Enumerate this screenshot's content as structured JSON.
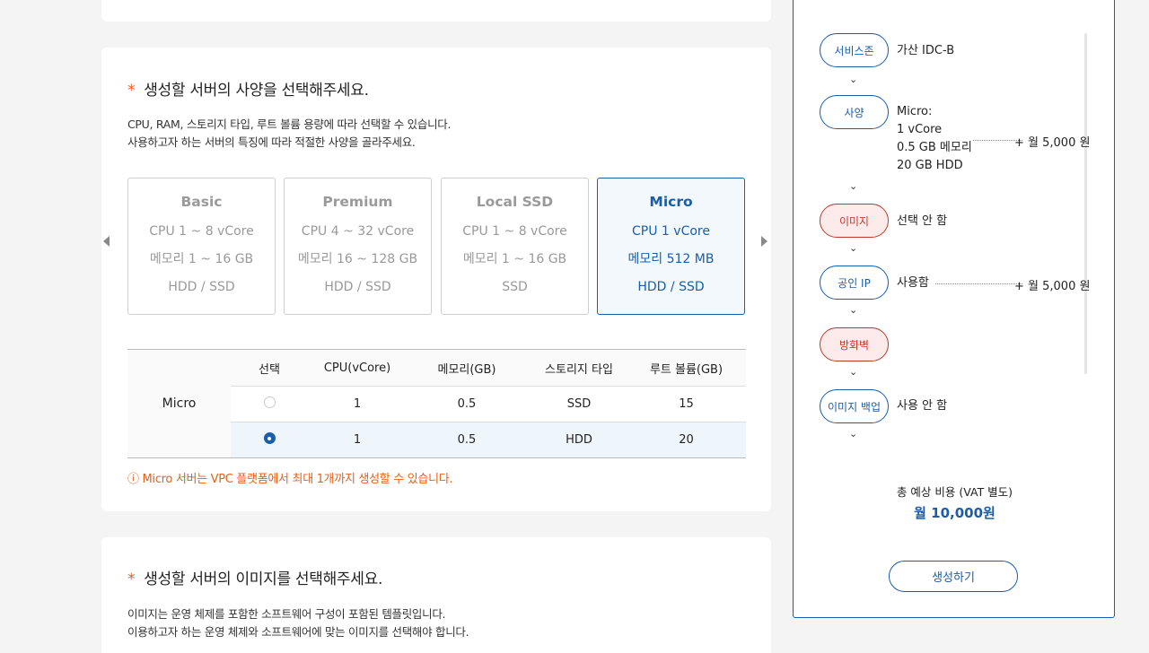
{
  "spec_section": {
    "title": "생성할 서버의 사양을 선택해주세요.",
    "desc_line1": "CPU, RAM, 스토리지 타입, 루트 볼륨 용량에 따라 선택할 수 있습니다.",
    "desc_line2": "사용하고자 하는 서버의 특징에 따라 적절한 사양을 골라주세요.",
    "cards": [
      {
        "title": "Basic",
        "cpu": "CPU 1 ~ 8 vCore",
        "mem": "메모리 1 ~ 16 GB",
        "storage": "HDD / SSD"
      },
      {
        "title": "Premium",
        "cpu": "CPU 4 ~ 32 vCore",
        "mem": "메모리 16 ~ 128 GB",
        "storage": "HDD / SSD"
      },
      {
        "title": "Local SSD",
        "cpu": "CPU 1 ~ 8 vCore",
        "mem": "메모리 1 ~ 16 GB",
        "storage": "SSD"
      },
      {
        "title": "Micro",
        "cpu": "CPU 1 vCore",
        "mem": "메모리 512 MB",
        "storage": "HDD / SSD"
      }
    ],
    "table": {
      "headers": [
        "선택",
        "CPU(vCore)",
        "메모리(GB)",
        "스토리지 타입",
        "루트 볼륨(GB)"
      ],
      "group": "Micro",
      "rows": [
        {
          "cpu": "1",
          "mem": "0.5",
          "storage": "SSD",
          "root": "15",
          "selected": false
        },
        {
          "cpu": "1",
          "mem": "0.5",
          "storage": "HDD",
          "root": "20",
          "selected": true
        }
      ]
    },
    "notice": "ⓘ Micro 서버는 VPC 플랫폼에서 최대 1개까지 생성할 수 있습니다."
  },
  "image_section": {
    "title": "생성할 서버의 이미지를 선택해주세요.",
    "desc_line1": "이미지는 운영 체제를 포함한 소프트웨어 구성이 포함된 템플릿입니다.",
    "desc_line2": "이용하고자 하는 운영 체제와 소프트웨어에 맞는 이미지를 선택해야 합니다."
  },
  "summary": {
    "steps": [
      {
        "label": "서비스존",
        "value": "가산 IDC-B"
      },
      {
        "label": "사양",
        "value_lines": [
          "Micro:",
          "1 vCore",
          "0.5 GB 메모리",
          "20 GB HDD"
        ],
        "price": "+ 월 5,000 원"
      },
      {
        "label": "이미지",
        "value": "선택 안 함"
      },
      {
        "label": "공인 IP",
        "value": "사용함",
        "price": "+ 월 5,000 원"
      },
      {
        "label": "방화벽",
        "value": ""
      },
      {
        "label": "이미지 백업",
        "value": "사용 안 함"
      }
    ],
    "total_label": "총 예상 비용 (VAT 별도)",
    "total_value": "월 10,000원",
    "create_label": "생성하기"
  }
}
